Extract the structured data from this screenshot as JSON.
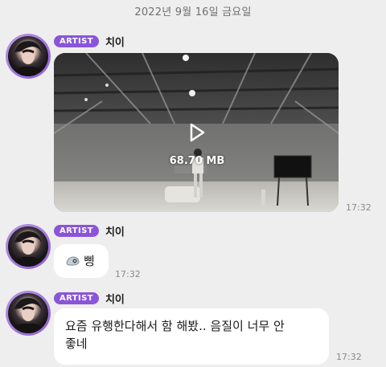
{
  "chat": {
    "date_header": "2022년 9월 16일 금요일",
    "messages": [
      {
        "badge": "ARTIST",
        "sender": "치이",
        "type": "video",
        "file_size": "68.70 MB",
        "time": "17:32"
      },
      {
        "badge": "ARTIST",
        "sender": "치이",
        "type": "text",
        "icon": "speaker-emoji-icon",
        "text": "삥",
        "time": "17:32"
      },
      {
        "badge": "ARTIST",
        "sender": "치이",
        "type": "text",
        "text_line1": "요즘 유행한다해서 함 해봤.. 음질이 너무 안",
        "text_line2": "좋네",
        "time": "17:32"
      }
    ]
  },
  "colors": {
    "background": "#eeeeee",
    "badge": "#8a55d9",
    "avatar_ring": "#a97ae0",
    "bubble": "#ffffff",
    "time": "#8a8a8a"
  }
}
